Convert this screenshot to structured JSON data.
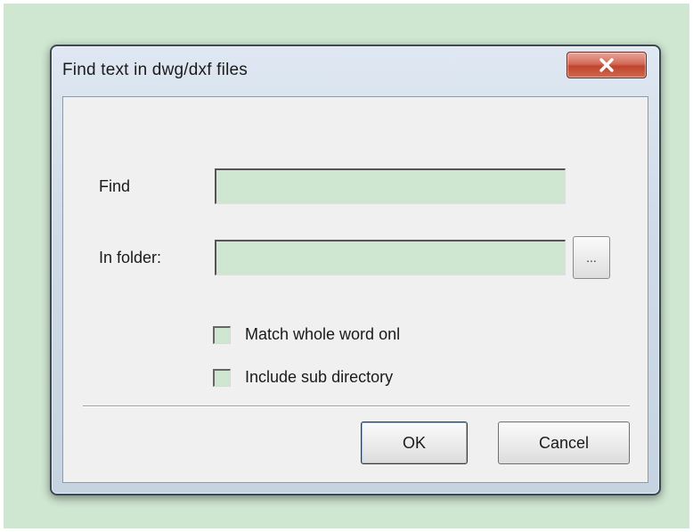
{
  "window": {
    "title": "Find text in dwg/dxf files",
    "close_icon": "close-x-icon"
  },
  "form": {
    "find_label": "Find",
    "find_value": "",
    "folder_label": "In folder:",
    "folder_value": "",
    "browse_label": "...",
    "match_whole_word": {
      "label": "Match whole word onl",
      "checked": false
    },
    "include_sub_directory": {
      "label": "Include sub directory",
      "checked": false
    }
  },
  "buttons": {
    "ok_label": "OK",
    "cancel_label": "Cancel"
  },
  "colors": {
    "desktop_background": "#cfe6d1",
    "close_button": "#c94b34",
    "field_background": "#cfe6d1"
  }
}
